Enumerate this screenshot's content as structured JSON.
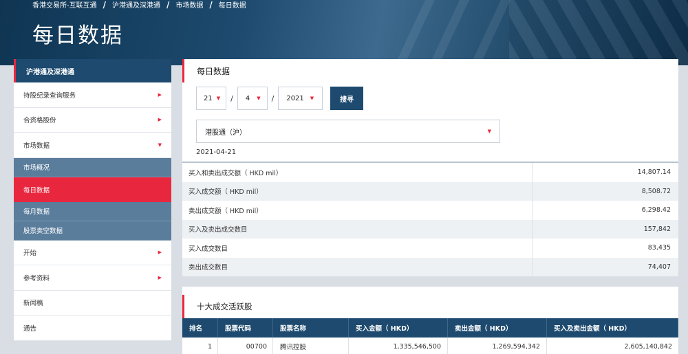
{
  "breadcrumb": [
    "香港交易所-互联互通",
    "沪港通及深港通",
    "市场数据",
    "每日数据"
  ],
  "page_title": "每日数据",
  "sidebar": {
    "header": "沪港通及深港通",
    "items": [
      {
        "label": "持股纪录查询服务"
      },
      {
        "label": "合资格股份"
      },
      {
        "label": "市场数据"
      }
    ],
    "sub_items": [
      {
        "label": "市场概况"
      },
      {
        "label": "每日数据"
      },
      {
        "label": "每月数据"
      },
      {
        "label": "股票卖空数据"
      }
    ],
    "items_after": [
      {
        "label": "开始"
      },
      {
        "label": "参考资料"
      },
      {
        "label": "新闻稿"
      },
      {
        "label": "通告"
      }
    ]
  },
  "main": {
    "title": "每日数据",
    "day": "21",
    "month": "4",
    "year": "2021",
    "search_label": "搜寻",
    "market": "港股通（沪）",
    "date": "2021-04-21",
    "stats": [
      {
        "label": "买入和卖出成交额（ HKD mil）",
        "value": "14,807.14"
      },
      {
        "label": "买入成交额（ HKD mil）",
        "value": "8,508.72"
      },
      {
        "label": "卖出成交额（ HKD mil）",
        "value": "6,298.42"
      },
      {
        "label": "买入及卖出成交数目",
        "value": "157,842"
      },
      {
        "label": "买入成交数目",
        "value": "83,435"
      },
      {
        "label": "卖出成交数目",
        "value": "74,407"
      }
    ]
  },
  "top10": {
    "title": "十大成交活跃股",
    "headers": [
      "排名",
      "股票代码",
      "股票名称",
      "买入金额（ HKD）",
      "卖出金额（ HKD）",
      "买入及卖出金额（ HKD）"
    ],
    "rows": [
      {
        "rank": "1",
        "code": "00700",
        "name": "腾讯控股",
        "buy": "1,335,546,500",
        "sell": "1,269,594,342",
        "total": "2,605,140,842"
      }
    ]
  },
  "colors": {
    "accent": "#e8273e",
    "navy": "#1d4a6e",
    "sub_nav": "#5a7d9c"
  }
}
